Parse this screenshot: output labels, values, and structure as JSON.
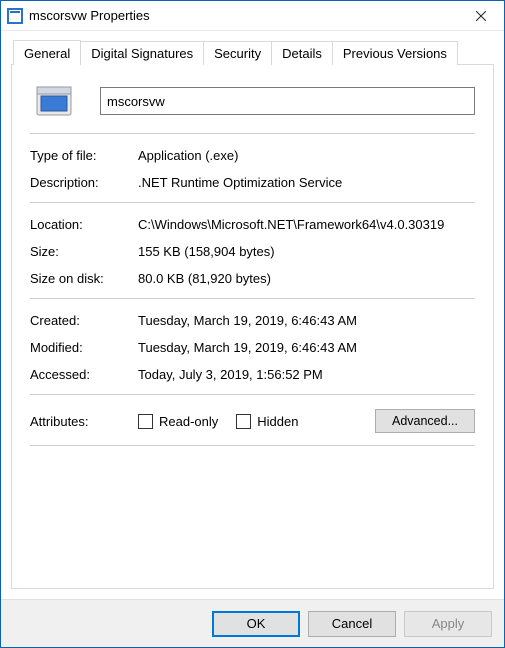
{
  "window": {
    "title": "mscorsvw Properties"
  },
  "tabs": {
    "general": "General",
    "digital_signatures": "Digital Signatures",
    "security": "Security",
    "details": "Details",
    "previous_versions": "Previous Versions"
  },
  "general": {
    "name_value": "mscorsvw",
    "labels": {
      "type_of_file": "Type of file:",
      "description": "Description:",
      "location": "Location:",
      "size": "Size:",
      "size_on_disk": "Size on disk:",
      "created": "Created:",
      "modified": "Modified:",
      "accessed": "Accessed:",
      "attributes": "Attributes:",
      "read_only": "Read-only",
      "hidden": "Hidden",
      "advanced": "Advanced..."
    },
    "values": {
      "type_of_file": "Application (.exe)",
      "description": ".NET Runtime Optimization Service",
      "location": "C:\\Windows\\Microsoft.NET\\Framework64\\v4.0.30319",
      "size": "155 KB (158,904 bytes)",
      "size_on_disk": "80.0 KB (81,920 bytes)",
      "created": "Tuesday, March 19, 2019, 6:46:43 AM",
      "modified": "Tuesday, March 19, 2019, 6:46:43 AM",
      "accessed": "Today, July 3, 2019, 1:56:52 PM"
    }
  },
  "buttons": {
    "ok": "OK",
    "cancel": "Cancel",
    "apply": "Apply"
  }
}
